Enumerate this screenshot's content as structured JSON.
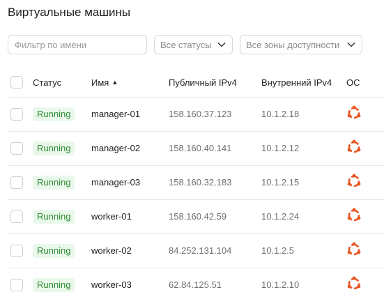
{
  "page": {
    "title": "Виртуальные машины"
  },
  "filters": {
    "name_placeholder": "Фильтр по имени",
    "status_select": "Все статусы",
    "zone_select": "Все зоны доступности"
  },
  "table": {
    "columns": {
      "status": "Статус",
      "name": "Имя",
      "public_ip": "Публичный IPv4",
      "internal_ip": "Внутренний IPv4",
      "os": "ОС"
    },
    "sort": {
      "column": "name",
      "direction": "asc"
    },
    "rows": [
      {
        "status": "Running",
        "name": "manager-01",
        "public_ip": "158.160.37.123",
        "internal_ip": "10.1.2.18",
        "os_icon": "ubuntu-icon"
      },
      {
        "status": "Running",
        "name": "manager-02",
        "public_ip": "158.160.40.141",
        "internal_ip": "10.1.2.12",
        "os_icon": "ubuntu-icon"
      },
      {
        "status": "Running",
        "name": "manager-03",
        "public_ip": "158.160.32.183",
        "internal_ip": "10.1.2.15",
        "os_icon": "ubuntu-icon"
      },
      {
        "status": "Running",
        "name": "worker-01",
        "public_ip": "158.160.42.59",
        "internal_ip": "10.1.2.24",
        "os_icon": "ubuntu-icon"
      },
      {
        "status": "Running",
        "name": "worker-02",
        "public_ip": "84.252.131.104",
        "internal_ip": "10.1.2.5",
        "os_icon": "ubuntu-icon"
      },
      {
        "status": "Running",
        "name": "worker-03",
        "public_ip": "62.84.125.51",
        "internal_ip": "10.1.2.10",
        "os_icon": "ubuntu-icon"
      }
    ]
  },
  "colors": {
    "running_badge_bg": "#e9f8ea",
    "running_badge_text": "#2e8b36",
    "ubuntu_orange": "#e95420"
  }
}
